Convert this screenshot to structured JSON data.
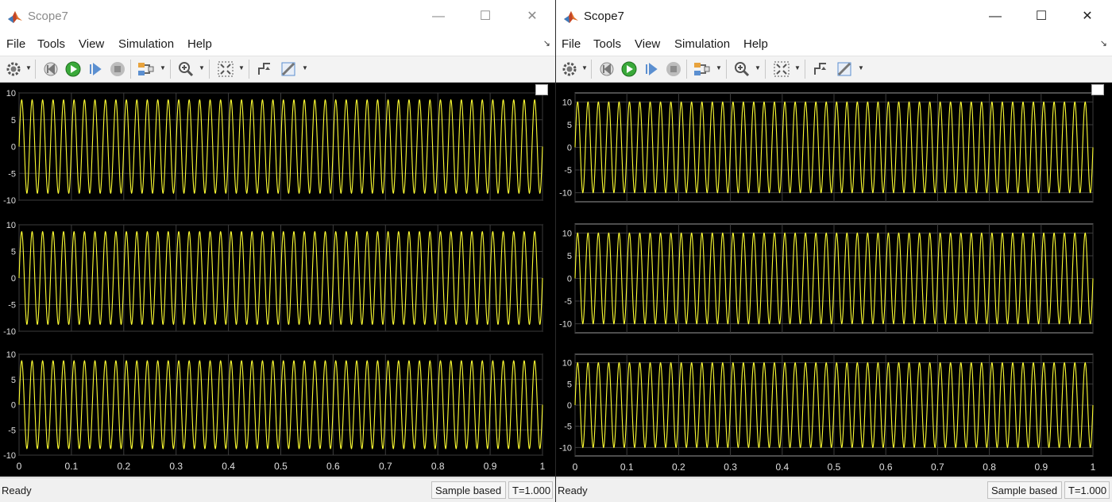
{
  "windows": [
    {
      "title": "Scope7",
      "active": false,
      "menu": [
        "File",
        "Tools",
        "View",
        "Simulation",
        "Help"
      ],
      "controls": {
        "minimize": "—",
        "maximize": "☐",
        "close": "✕"
      },
      "status": {
        "ready": "Ready",
        "mode": "Sample based",
        "time": "T=1.000"
      },
      "plots": [
        {
          "ylim": [
            -10,
            10
          ],
          "yticks": [
            "10",
            "5",
            "0",
            "-5",
            "-10"
          ],
          "amplitude": 8.7,
          "frequency_hz": 50,
          "color": "#ffff33"
        },
        {
          "ylim": [
            -10,
            10
          ],
          "yticks": [
            "10",
            "5",
            "0",
            "-5",
            "-10"
          ],
          "amplitude": 8.7,
          "frequency_hz": 50,
          "color": "#ffff33"
        },
        {
          "ylim": [
            -10,
            10
          ],
          "yticks": [
            "10",
            "5",
            "0",
            "-5",
            "-10"
          ],
          "amplitude": 8.7,
          "frequency_hz": 50,
          "color": "#ffff33"
        }
      ],
      "xticks": [
        "0",
        "0.1",
        "0.2",
        "0.3",
        "0.4",
        "0.5",
        "0.6",
        "0.7",
        "0.8",
        "0.9",
        "1"
      ]
    },
    {
      "title": "Scope7",
      "active": true,
      "menu": [
        "File",
        "Tools",
        "View",
        "Simulation",
        "Help"
      ],
      "controls": {
        "minimize": "—",
        "maximize": "☐",
        "close": "✕"
      },
      "status": {
        "ready": "Ready",
        "mode": "Sample based",
        "time": "T=1.000"
      },
      "plots": [
        {
          "ylim": [
            -12,
            12
          ],
          "yticks": [
            "10",
            "5",
            "0",
            "-5",
            "-10"
          ],
          "amplitude": 10,
          "frequency_hz": 50,
          "color": "#ffff33"
        },
        {
          "ylim": [
            -12,
            12
          ],
          "yticks": [
            "10",
            "5",
            "0",
            "-5",
            "-10"
          ],
          "amplitude": 10,
          "frequency_hz": 50,
          "color": "#ffff33"
        },
        {
          "ylim": [
            -12,
            12
          ],
          "yticks": [
            "10",
            "5",
            "0",
            "-5",
            "-10"
          ],
          "amplitude": 10,
          "frequency_hz": 50,
          "color": "#ffff33"
        }
      ],
      "xticks": [
        "0",
        "0.1",
        "0.2",
        "0.3",
        "0.4",
        "0.5",
        "0.6",
        "0.7",
        "0.8",
        "0.9",
        "1"
      ]
    }
  ],
  "chart_data": [
    {
      "type": "line",
      "window": 1,
      "x_range": [
        0,
        1
      ],
      "ylim": [
        -10,
        10
      ],
      "series": [
        {
          "signal": "sine",
          "amplitude": 8.7,
          "frequency_hz": 50
        }
      ]
    },
    {
      "type": "line",
      "window": 1,
      "x_range": [
        0,
        1
      ],
      "ylim": [
        -10,
        10
      ],
      "series": [
        {
          "signal": "sine",
          "amplitude": 8.7,
          "frequency_hz": 50
        }
      ]
    },
    {
      "type": "line",
      "window": 1,
      "x_range": [
        0,
        1
      ],
      "ylim": [
        -10,
        10
      ],
      "series": [
        {
          "signal": "sine",
          "amplitude": 8.7,
          "frequency_hz": 50
        }
      ]
    },
    {
      "type": "line",
      "window": 2,
      "x_range": [
        0,
        1
      ],
      "ylim": [
        -12,
        12
      ],
      "series": [
        {
          "signal": "sine",
          "amplitude": 10,
          "frequency_hz": 50
        }
      ]
    },
    {
      "type": "line",
      "window": 2,
      "x_range": [
        0,
        1
      ],
      "ylim": [
        -12,
        12
      ],
      "series": [
        {
          "signal": "sine",
          "amplitude": 10,
          "frequency_hz": 50
        }
      ]
    },
    {
      "type": "line",
      "window": 2,
      "x_range": [
        0,
        1
      ],
      "ylim": [
        -12,
        12
      ],
      "series": [
        {
          "signal": "sine",
          "amplitude": 10,
          "frequency_hz": 50
        }
      ]
    }
  ]
}
